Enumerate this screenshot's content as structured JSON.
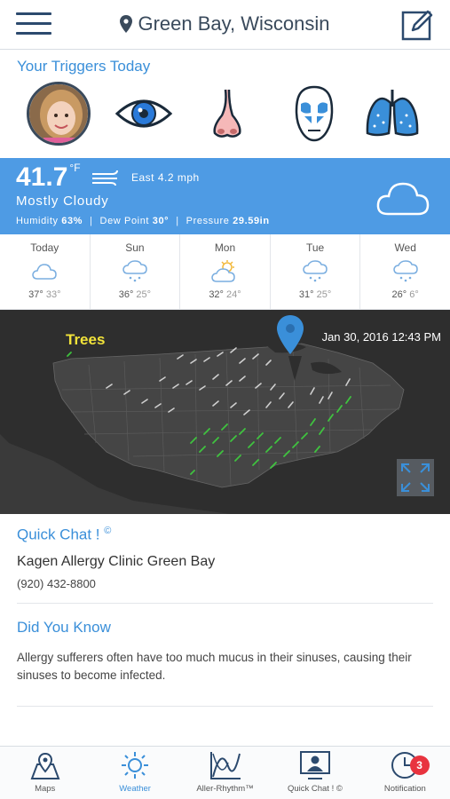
{
  "header": {
    "location": "Green Bay, Wisconsin",
    "icons": [
      "menu-icon",
      "location-pin-icon",
      "edit-note-icon"
    ]
  },
  "triggers": {
    "title": "Your Triggers Today",
    "items": [
      {
        "name": "avatar"
      },
      {
        "name": "eye-icon"
      },
      {
        "name": "nose-icon"
      },
      {
        "name": "sinus-face-icon"
      },
      {
        "name": "lungs-icon"
      }
    ]
  },
  "weather": {
    "temperature": "41.7",
    "unit": "°F",
    "wind": "East 4.2 mph",
    "condition": "Mostly Cloudy",
    "humidity_label": "Humidity",
    "humidity": "63%",
    "dewpoint_label": "Dew Point",
    "dewpoint": "30°",
    "pressure_label": "Pressure",
    "pressure": "29.59in",
    "bg_color": "#4e9be4"
  },
  "forecast": [
    {
      "day": "Today",
      "hi": "37°",
      "lo": "33°",
      "icon": "cloud-icon"
    },
    {
      "day": "Sun",
      "hi": "36°",
      "lo": "25°",
      "icon": "snow-cloud-icon"
    },
    {
      "day": "Mon",
      "hi": "32°",
      "lo": "24°",
      "icon": "partly-sunny-icon"
    },
    {
      "day": "Tue",
      "hi": "31°",
      "lo": "25°",
      "icon": "snow-cloud-icon"
    },
    {
      "day": "Wed",
      "hi": "26°",
      "lo": "6°",
      "icon": "snow-cloud-icon"
    }
  ],
  "map": {
    "layer": "Trees",
    "timestamp": "Jan 30, 2016 12:43 PM"
  },
  "quick_chat": {
    "title": "Quick Chat !",
    "mark": "©",
    "clinic": "Kagen Allergy Clinic Green Bay",
    "phone": "(920) 432-8800"
  },
  "did_you_know": {
    "title": "Did You Know",
    "text": "Allergy sufferers often have too much mucus in their sinuses, causing their sinuses to become infected."
  },
  "tabs": [
    {
      "label": "Maps",
      "icon": "map-icon"
    },
    {
      "label": "Weather",
      "icon": "sun-icon",
      "active": true
    },
    {
      "label": "Aller-Rhythm™",
      "icon": "chart-icon"
    },
    {
      "label": "Quick Chat ! ©",
      "icon": "doctor-icon"
    },
    {
      "label": "Notification",
      "icon": "clock-icon",
      "badge": "3"
    }
  ],
  "colors": {
    "accent": "#3a8fd9",
    "dark": "#2c4a6e",
    "badge": "#e8333f"
  }
}
